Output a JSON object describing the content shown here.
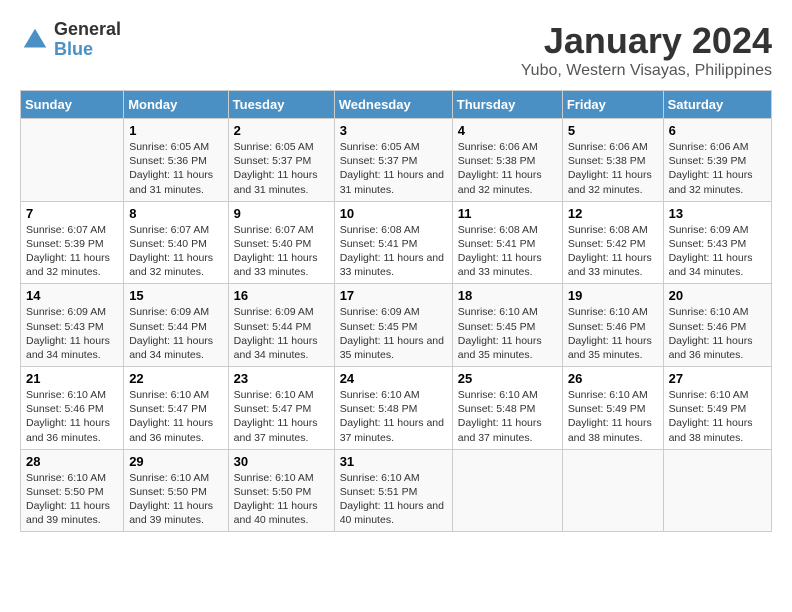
{
  "logo": {
    "general": "General",
    "blue": "Blue"
  },
  "title": "January 2024",
  "location": "Yubo, Western Visayas, Philippines",
  "days_header": [
    "Sunday",
    "Monday",
    "Tuesday",
    "Wednesday",
    "Thursday",
    "Friday",
    "Saturday"
  ],
  "weeks": [
    [
      {
        "num": "",
        "sunrise": "",
        "sunset": "",
        "daylight": ""
      },
      {
        "num": "1",
        "sunrise": "Sunrise: 6:05 AM",
        "sunset": "Sunset: 5:36 PM",
        "daylight": "Daylight: 11 hours and 31 minutes."
      },
      {
        "num": "2",
        "sunrise": "Sunrise: 6:05 AM",
        "sunset": "Sunset: 5:37 PM",
        "daylight": "Daylight: 11 hours and 31 minutes."
      },
      {
        "num": "3",
        "sunrise": "Sunrise: 6:05 AM",
        "sunset": "Sunset: 5:37 PM",
        "daylight": "Daylight: 11 hours and 31 minutes."
      },
      {
        "num": "4",
        "sunrise": "Sunrise: 6:06 AM",
        "sunset": "Sunset: 5:38 PM",
        "daylight": "Daylight: 11 hours and 32 minutes."
      },
      {
        "num": "5",
        "sunrise": "Sunrise: 6:06 AM",
        "sunset": "Sunset: 5:38 PM",
        "daylight": "Daylight: 11 hours and 32 minutes."
      },
      {
        "num": "6",
        "sunrise": "Sunrise: 6:06 AM",
        "sunset": "Sunset: 5:39 PM",
        "daylight": "Daylight: 11 hours and 32 minutes."
      }
    ],
    [
      {
        "num": "7",
        "sunrise": "Sunrise: 6:07 AM",
        "sunset": "Sunset: 5:39 PM",
        "daylight": "Daylight: 11 hours and 32 minutes."
      },
      {
        "num": "8",
        "sunrise": "Sunrise: 6:07 AM",
        "sunset": "Sunset: 5:40 PM",
        "daylight": "Daylight: 11 hours and 32 minutes."
      },
      {
        "num": "9",
        "sunrise": "Sunrise: 6:07 AM",
        "sunset": "Sunset: 5:40 PM",
        "daylight": "Daylight: 11 hours and 33 minutes."
      },
      {
        "num": "10",
        "sunrise": "Sunrise: 6:08 AM",
        "sunset": "Sunset: 5:41 PM",
        "daylight": "Daylight: 11 hours and 33 minutes."
      },
      {
        "num": "11",
        "sunrise": "Sunrise: 6:08 AM",
        "sunset": "Sunset: 5:41 PM",
        "daylight": "Daylight: 11 hours and 33 minutes."
      },
      {
        "num": "12",
        "sunrise": "Sunrise: 6:08 AM",
        "sunset": "Sunset: 5:42 PM",
        "daylight": "Daylight: 11 hours and 33 minutes."
      },
      {
        "num": "13",
        "sunrise": "Sunrise: 6:09 AM",
        "sunset": "Sunset: 5:43 PM",
        "daylight": "Daylight: 11 hours and 34 minutes."
      }
    ],
    [
      {
        "num": "14",
        "sunrise": "Sunrise: 6:09 AM",
        "sunset": "Sunset: 5:43 PM",
        "daylight": "Daylight: 11 hours and 34 minutes."
      },
      {
        "num": "15",
        "sunrise": "Sunrise: 6:09 AM",
        "sunset": "Sunset: 5:44 PM",
        "daylight": "Daylight: 11 hours and 34 minutes."
      },
      {
        "num": "16",
        "sunrise": "Sunrise: 6:09 AM",
        "sunset": "Sunset: 5:44 PM",
        "daylight": "Daylight: 11 hours and 34 minutes."
      },
      {
        "num": "17",
        "sunrise": "Sunrise: 6:09 AM",
        "sunset": "Sunset: 5:45 PM",
        "daylight": "Daylight: 11 hours and 35 minutes."
      },
      {
        "num": "18",
        "sunrise": "Sunrise: 6:10 AM",
        "sunset": "Sunset: 5:45 PM",
        "daylight": "Daylight: 11 hours and 35 minutes."
      },
      {
        "num": "19",
        "sunrise": "Sunrise: 6:10 AM",
        "sunset": "Sunset: 5:46 PM",
        "daylight": "Daylight: 11 hours and 35 minutes."
      },
      {
        "num": "20",
        "sunrise": "Sunrise: 6:10 AM",
        "sunset": "Sunset: 5:46 PM",
        "daylight": "Daylight: 11 hours and 36 minutes."
      }
    ],
    [
      {
        "num": "21",
        "sunrise": "Sunrise: 6:10 AM",
        "sunset": "Sunset: 5:46 PM",
        "daylight": "Daylight: 11 hours and 36 minutes."
      },
      {
        "num": "22",
        "sunrise": "Sunrise: 6:10 AM",
        "sunset": "Sunset: 5:47 PM",
        "daylight": "Daylight: 11 hours and 36 minutes."
      },
      {
        "num": "23",
        "sunrise": "Sunrise: 6:10 AM",
        "sunset": "Sunset: 5:47 PM",
        "daylight": "Daylight: 11 hours and 37 minutes."
      },
      {
        "num": "24",
        "sunrise": "Sunrise: 6:10 AM",
        "sunset": "Sunset: 5:48 PM",
        "daylight": "Daylight: 11 hours and 37 minutes."
      },
      {
        "num": "25",
        "sunrise": "Sunrise: 6:10 AM",
        "sunset": "Sunset: 5:48 PM",
        "daylight": "Daylight: 11 hours and 37 minutes."
      },
      {
        "num": "26",
        "sunrise": "Sunrise: 6:10 AM",
        "sunset": "Sunset: 5:49 PM",
        "daylight": "Daylight: 11 hours and 38 minutes."
      },
      {
        "num": "27",
        "sunrise": "Sunrise: 6:10 AM",
        "sunset": "Sunset: 5:49 PM",
        "daylight": "Daylight: 11 hours and 38 minutes."
      }
    ],
    [
      {
        "num": "28",
        "sunrise": "Sunrise: 6:10 AM",
        "sunset": "Sunset: 5:50 PM",
        "daylight": "Daylight: 11 hours and 39 minutes."
      },
      {
        "num": "29",
        "sunrise": "Sunrise: 6:10 AM",
        "sunset": "Sunset: 5:50 PM",
        "daylight": "Daylight: 11 hours and 39 minutes."
      },
      {
        "num": "30",
        "sunrise": "Sunrise: 6:10 AM",
        "sunset": "Sunset: 5:50 PM",
        "daylight": "Daylight: 11 hours and 40 minutes."
      },
      {
        "num": "31",
        "sunrise": "Sunrise: 6:10 AM",
        "sunset": "Sunset: 5:51 PM",
        "daylight": "Daylight: 11 hours and 40 minutes."
      },
      {
        "num": "",
        "sunrise": "",
        "sunset": "",
        "daylight": ""
      },
      {
        "num": "",
        "sunrise": "",
        "sunset": "",
        "daylight": ""
      },
      {
        "num": "",
        "sunrise": "",
        "sunset": "",
        "daylight": ""
      }
    ]
  ]
}
